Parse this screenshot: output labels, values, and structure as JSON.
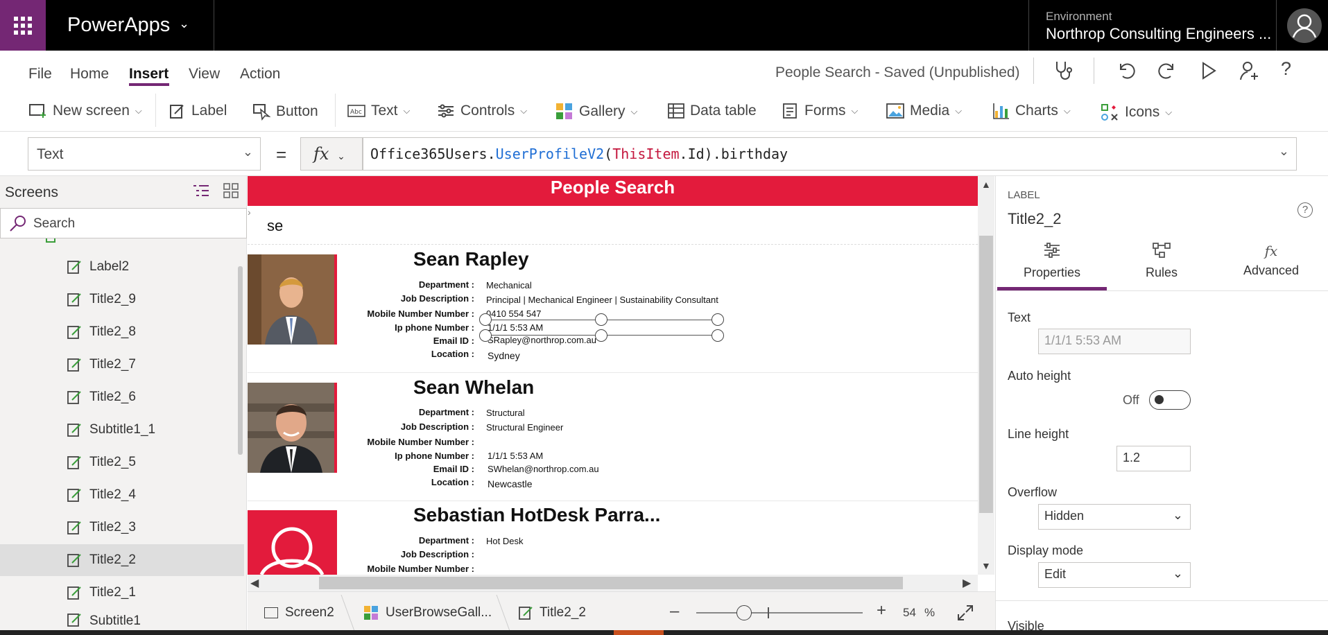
{
  "app": {
    "name": "PowerApps",
    "environment_label": "Environment",
    "environment_name": "Northrop Consulting Engineers ..."
  },
  "menu": {
    "items": [
      "File",
      "Home",
      "Insert",
      "View",
      "Action"
    ],
    "active": "Insert",
    "saved_status": "People Search - Saved (Unpublished)"
  },
  "ribbon": {
    "new_screen": "New screen",
    "label": "Label",
    "button": "Button",
    "text": "Text",
    "controls": "Controls",
    "gallery": "Gallery",
    "data_table": "Data table",
    "forms": "Forms",
    "media": "Media",
    "charts": "Charts",
    "icons": "Icons"
  },
  "formula_bar": {
    "property": "Text",
    "eq": "=",
    "fx": "fx",
    "formula_parts": [
      "Office365Users.",
      "UserProfileV2",
      "(",
      "ThisItem",
      ".Id).birthday"
    ]
  },
  "left_panel": {
    "title": "Screens",
    "search_placeholder": "Search",
    "items": [
      "Label2",
      "Title2_9",
      "Title2_8",
      "Title2_7",
      "Title2_6",
      "Subtitle1_1",
      "Title2_5",
      "Title2_4",
      "Title2_3",
      "Title2_2",
      "Title2_1",
      "Subtitle1"
    ],
    "selected": "Title2_2"
  },
  "canvas": {
    "header": "People Search",
    "search_value": "se",
    "labels": {
      "department": "Department :",
      "job": "Job Description :",
      "mobile": "Mobile Number Number :",
      "ip": "Ip phone Number :",
      "email": "Email ID :",
      "location": "Location :"
    },
    "people": [
      {
        "name": "Sean Rapley",
        "department": "Mechanical",
        "job": "Principal | Mechanical Engineer | Sustainability Consultant",
        "mobile": "0410 554 547",
        "ip": "1/1/1 5:53 AM",
        "email": "SRapley@northrop.com.au",
        "location": "Sydney"
      },
      {
        "name": "Sean Whelan",
        "department": "Structural",
        "job": "Structural Engineer",
        "mobile": "",
        "ip": "1/1/1 5:53 AM",
        "email": "SWhelan@northrop.com.au",
        "location": "Newcastle"
      },
      {
        "name": "Sebastian HotDesk Parra...",
        "department": "Hot Desk",
        "job": "",
        "mobile": ""
      }
    ]
  },
  "right_panel": {
    "type": "LABEL",
    "control_name": "Title2_2",
    "tabs": [
      "Properties",
      "Rules",
      "Advanced"
    ],
    "text_label": "Text",
    "text_value": "1/1/1 5:53 AM",
    "auto_height_label": "Auto height",
    "auto_height_state": "Off",
    "line_height_label": "Line height",
    "line_height_value": "1.2",
    "overflow_label": "Overflow",
    "overflow_value": "Hidden",
    "display_mode_label": "Display mode",
    "display_mode_value": "Edit",
    "visible_label": "Visible"
  },
  "bottom": {
    "screen": "Screen2",
    "gallery": "UserBrowseGall...",
    "control": "Title2_2",
    "zoom": "54",
    "zoom_unit": "%"
  },
  "colors": {
    "brand": "#742774",
    "accent_red": "#e31b3c"
  }
}
